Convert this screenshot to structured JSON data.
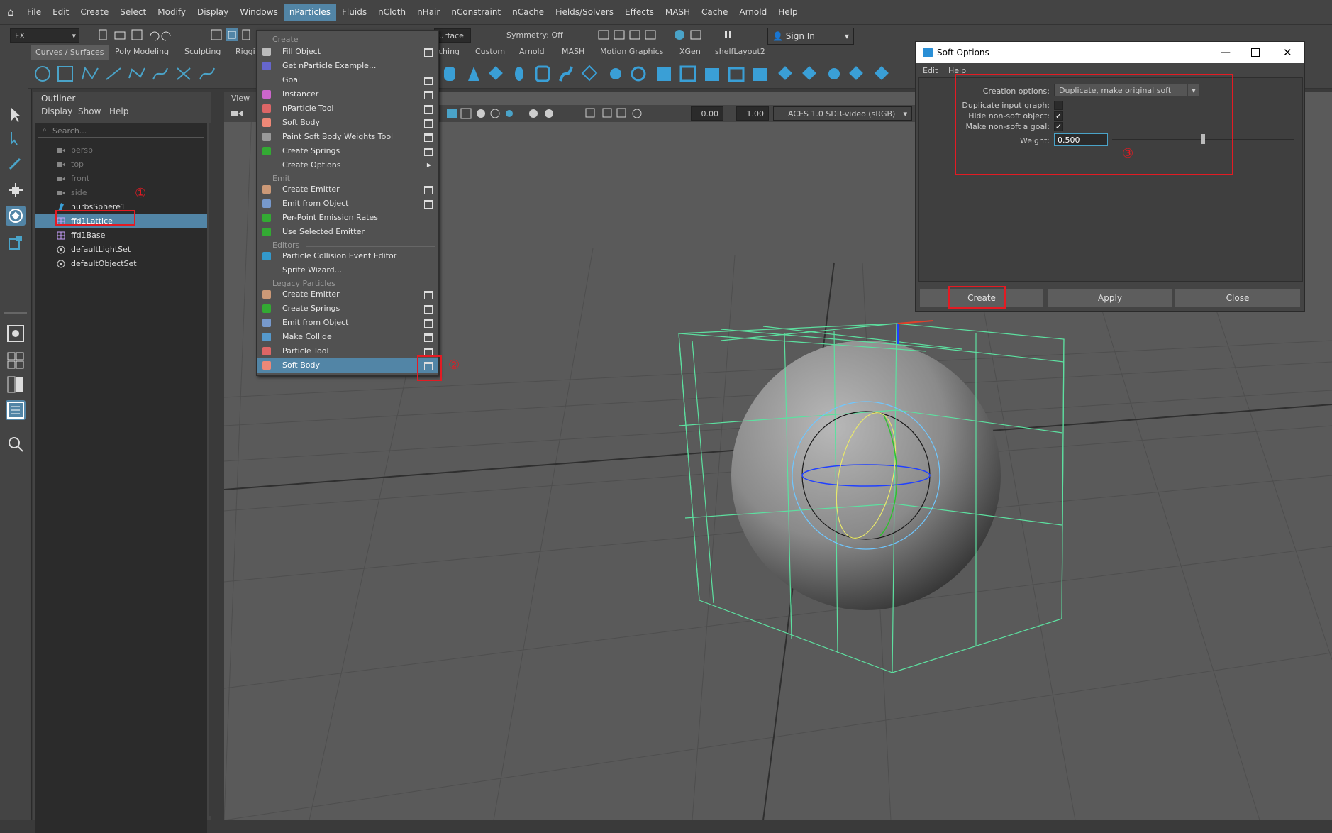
{
  "menubar": {
    "items": [
      "File",
      "Edit",
      "Create",
      "Select",
      "Modify",
      "Display",
      "Windows",
      "nParticles",
      "Fluids",
      "nCloth",
      "nHair",
      "nConstraint",
      "nCache",
      "Fields/Solvers",
      "Effects",
      "MASH",
      "Cache",
      "Arnold",
      "Help"
    ],
    "active": "nParticles"
  },
  "statusline": {
    "mode": "FX",
    "live_surface": "urface",
    "symmetry": "Symmetry: Off",
    "sign_in": "Sign In"
  },
  "shelf": {
    "tabs": [
      "Curves / Surfaces",
      "Poly Modeling",
      "Sculpting",
      "Riggi",
      "ching",
      "Custom",
      "Arnold",
      "MASH",
      "Motion Graphics",
      "XGen",
      "shelfLayout2"
    ]
  },
  "outliner": {
    "title": "Outliner",
    "menu": [
      "Display",
      "Show",
      "Help"
    ],
    "search_placeholder": "Search...",
    "items": [
      {
        "label": "persp",
        "icon": "camera-icon",
        "state": "dim"
      },
      {
        "label": "top",
        "icon": "camera-icon",
        "state": "dim"
      },
      {
        "label": "front",
        "icon": "camera-icon",
        "state": "dim"
      },
      {
        "label": "side",
        "icon": "camera-icon",
        "state": "dim"
      },
      {
        "label": "nurbsSphere1",
        "icon": "nurbs-icon",
        "state": "normal"
      },
      {
        "label": "ffd1Lattice",
        "icon": "lattice-icon",
        "state": "selected"
      },
      {
        "label": "ffd1Base",
        "icon": "lattice-icon",
        "state": "normal"
      },
      {
        "label": "defaultLightSet",
        "icon": "set-icon",
        "state": "normal"
      },
      {
        "label": "defaultObjectSet",
        "icon": "set-icon",
        "state": "normal"
      }
    ]
  },
  "viewport": {
    "view_label": "View",
    "field1": "0.00",
    "field2": "1.00",
    "colorspace": "ACES 1.0 SDR-video (sRGB)"
  },
  "dropdown": {
    "sections": {
      "create": "Create",
      "emit": "Emit",
      "editors": "Editors",
      "legacy": "Legacy Particles"
    },
    "create_items": [
      {
        "label": "Fill Object",
        "option": true
      },
      {
        "label": "Get nParticle Example...",
        "option": false
      },
      {
        "label": "Goal",
        "option": true
      },
      {
        "label": "Instancer",
        "option": true
      },
      {
        "label": "nParticle Tool",
        "option": true
      },
      {
        "label": "Soft Body",
        "option": true
      },
      {
        "label": "Paint Soft Body Weights Tool",
        "option": true
      },
      {
        "label": "Create Springs",
        "option": true
      },
      {
        "label": "Create Options",
        "option": false
      }
    ],
    "emit_items": [
      {
        "label": "Create Emitter",
        "option": true
      },
      {
        "label": "Emit from Object",
        "option": true
      },
      {
        "label": "Per-Point Emission Rates",
        "option": false
      },
      {
        "label": "Use Selected Emitter",
        "option": false
      }
    ],
    "editor_items": [
      {
        "label": "Particle Collision Event Editor",
        "option": false
      },
      {
        "label": "Sprite Wizard...",
        "option": false
      }
    ],
    "legacy_items": [
      {
        "label": "Create Emitter",
        "option": true
      },
      {
        "label": "Create Springs",
        "option": true
      },
      {
        "label": "Emit from Object",
        "option": true
      },
      {
        "label": "Make Collide",
        "option": true
      },
      {
        "label": "Particle Tool",
        "option": true
      },
      {
        "label": "Soft Body",
        "option": true
      }
    ]
  },
  "dialog": {
    "title": "Soft Options",
    "menu": [
      "Edit",
      "Help"
    ],
    "creation_options_label": "Creation options:",
    "creation_options_value": "Duplicate, make original soft",
    "duplicate_label": "Duplicate input graph:",
    "duplicate_checked": false,
    "hide_label": "Hide non-soft object:",
    "hide_checked": true,
    "goal_label": "Make non-soft a goal:",
    "goal_checked": true,
    "weight_label": "Weight:",
    "weight_value": "0.500",
    "weight_fraction": 0.5,
    "buttons": {
      "create": "Create",
      "apply": "Apply",
      "close": "Close"
    }
  },
  "annotations": {
    "one": "①",
    "two": "②",
    "three": "③",
    "color": "#e31b23"
  },
  "colors": {
    "highlight": "#5285a6",
    "lattice": "#5de0a0"
  }
}
